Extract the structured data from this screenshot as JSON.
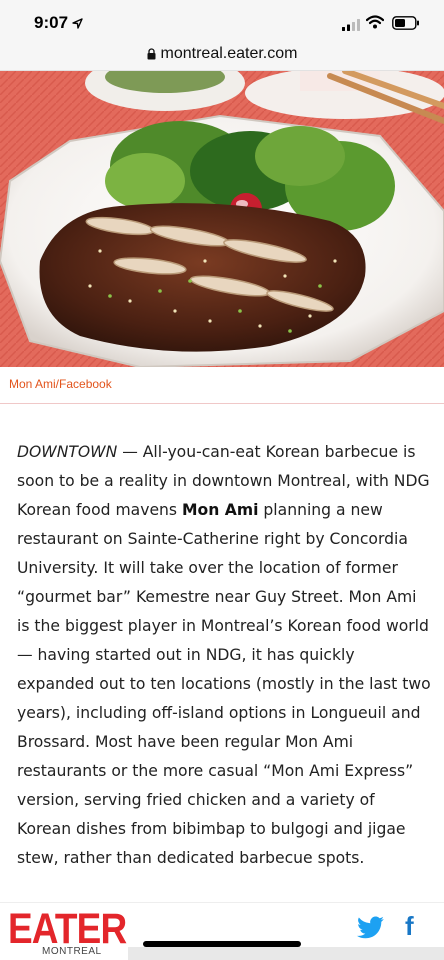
{
  "status_bar": {
    "time": "9:07"
  },
  "browser": {
    "url": "montreal.eater.com"
  },
  "hero": {
    "photo_credit": "Mon Ami/Facebook"
  },
  "article": {
    "dateline": "DOWNTOWN",
    "text_1": " — All-you-can-eat Korean barbecue is soon to be a reality in downtown Montreal, with NDG Korean food mavens ",
    "bold_name": "Mon Ami",
    "text_2": " planning a new restaurant on Sainte-Catherine right by Concordia University. It will take over the location of former “gourmet bar” Kemestre near Guy Street. Mon Ami is the biggest player in Montreal’s Korean food world — having started out in NDG, it has quickly expanded out to ten locations (mostly in the last two years), including off-island options in Longueuil and Brossard. Most have been regular Mon Ami restaurants or the more casual “Mon Ami Express” version, serving fried chicken and a variety of Korean dishes from bibimbap to bulgogi and jigae stew, rather than dedicated barbecue spots."
  },
  "footer": {
    "logo": "EATER",
    "logo_sub": "MONTREAL",
    "facebook_glyph": "f"
  },
  "colors": {
    "brand_red": "#e3262b",
    "credit_orange": "#e2541c",
    "twitter_blue": "#1da1f2",
    "facebook_blue": "#1877c6"
  },
  "icons": {
    "location": "location-arrow-icon",
    "signal": "cellular-signal-icon",
    "wifi": "wifi-icon",
    "battery": "battery-icon",
    "lock": "lock-icon",
    "twitter": "twitter-icon",
    "facebook": "facebook-icon"
  }
}
